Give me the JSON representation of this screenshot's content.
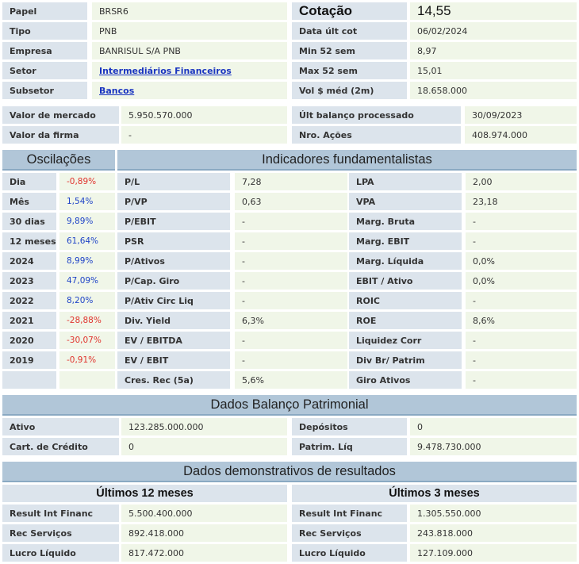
{
  "top": {
    "papel_label": "Papel",
    "papel": "BRSR6",
    "tipo_label": "Tipo",
    "tipo": "PNB",
    "empresa_label": "Empresa",
    "empresa": "BANRISUL S/A PNB",
    "setor_label": "Setor",
    "setor": "Intermediários Financeiros",
    "subsetor_label": "Subsetor",
    "subsetor": "Bancos",
    "cotacao_label": "Cotação",
    "cotacao": "14,55",
    "data_label": "Data últ cot",
    "data": "06/02/2024",
    "min_label": "Min 52 sem",
    "min": "8,97",
    "max_label": "Max 52 sem",
    "max": "15,01",
    "vol_label": "Vol $ méd (2m)",
    "vol": "18.658.000"
  },
  "mercado": {
    "valor_mercado_label": "Valor de mercado",
    "valor_mercado": "5.950.570.000",
    "valor_firma_label": "Valor da firma",
    "valor_firma": "-",
    "ult_balanco_label": "Últ balanço processado",
    "ult_balanco": "30/09/2023",
    "nro_acoes_label": "Nro. Ações",
    "nro_acoes": "408.974.000"
  },
  "oscilacoes": {
    "title": "Oscilações",
    "rows": [
      {
        "label": "Dia",
        "value": "-0,89%"
      },
      {
        "label": "Mês",
        "value": "1,54%"
      },
      {
        "label": "30 dias",
        "value": "9,89%"
      },
      {
        "label": "12 meses",
        "value": "61,64%"
      },
      {
        "label": "2024",
        "value": "8,99%"
      },
      {
        "label": "2023",
        "value": "47,09%"
      },
      {
        "label": "2022",
        "value": "8,20%"
      },
      {
        "label": "2021",
        "value": "-28,88%"
      },
      {
        "label": "2020",
        "value": "-30,07%"
      },
      {
        "label": "2019",
        "value": "-0,91%"
      }
    ]
  },
  "indicadores": {
    "title": "Indicadores fundamentalistas",
    "left": [
      {
        "label": "P/L",
        "value": "7,28"
      },
      {
        "label": "P/VP",
        "value": "0,63"
      },
      {
        "label": "P/EBIT",
        "value": "-"
      },
      {
        "label": "PSR",
        "value": "-"
      },
      {
        "label": "P/Ativos",
        "value": "-"
      },
      {
        "label": "P/Cap. Giro",
        "value": "-"
      },
      {
        "label": "P/Ativ Circ Liq",
        "value": "-"
      },
      {
        "label": "Div. Yield",
        "value": "6,3%"
      },
      {
        "label": "EV / EBITDA",
        "value": "-"
      },
      {
        "label": "EV / EBIT",
        "value": "-"
      },
      {
        "label": "Cres. Rec (5a)",
        "value": "5,6%"
      }
    ],
    "right": [
      {
        "label": "LPA",
        "value": "2,00"
      },
      {
        "label": "VPA",
        "value": "23,18"
      },
      {
        "label": "Marg. Bruta",
        "value": "-"
      },
      {
        "label": "Marg. EBIT",
        "value": "-"
      },
      {
        "label": "Marg. Líquida",
        "value": "0,0%"
      },
      {
        "label": "EBIT / Ativo",
        "value": "0,0%"
      },
      {
        "label": "ROIC",
        "value": "-"
      },
      {
        "label": "ROE",
        "value": "8,6%"
      },
      {
        "label": "Liquidez Corr",
        "value": "-"
      },
      {
        "label": "Div Br/ Patrim",
        "value": "-"
      },
      {
        "label": "Giro Ativos",
        "value": "-"
      }
    ]
  },
  "balanco": {
    "title": "Dados Balanço Patrimonial",
    "ativo_label": "Ativo",
    "ativo": "123.285.000.000",
    "cart_label": "Cart. de Crédito",
    "cart": "0",
    "depositos_label": "Depósitos",
    "depositos": "0",
    "patrim_label": "Patrim. Líq",
    "patrim": "9.478.730.000"
  },
  "resultados": {
    "title": "Dados demonstrativos de resultados",
    "left_title": "Últimos 12 meses",
    "right_title": "Últimos 3 meses",
    "left": [
      {
        "label": "Result Int Financ",
        "value": "5.500.400.000"
      },
      {
        "label": "Rec Serviços",
        "value": "892.418.000"
      },
      {
        "label": "Lucro Líquido",
        "value": "817.472.000"
      }
    ],
    "right": [
      {
        "label": "Result Int Financ",
        "value": "1.305.550.000"
      },
      {
        "label": "Rec Serviços",
        "value": "243.818.000"
      },
      {
        "label": "Lucro Líquido",
        "value": "127.109.000"
      }
    ]
  },
  "colors": {
    "negative": "#e0332d",
    "positive": "#1f44c7",
    "header": "#b1c6d8",
    "label_bg": "#dce4ec",
    "value_bg": "#f0f6e8"
  }
}
